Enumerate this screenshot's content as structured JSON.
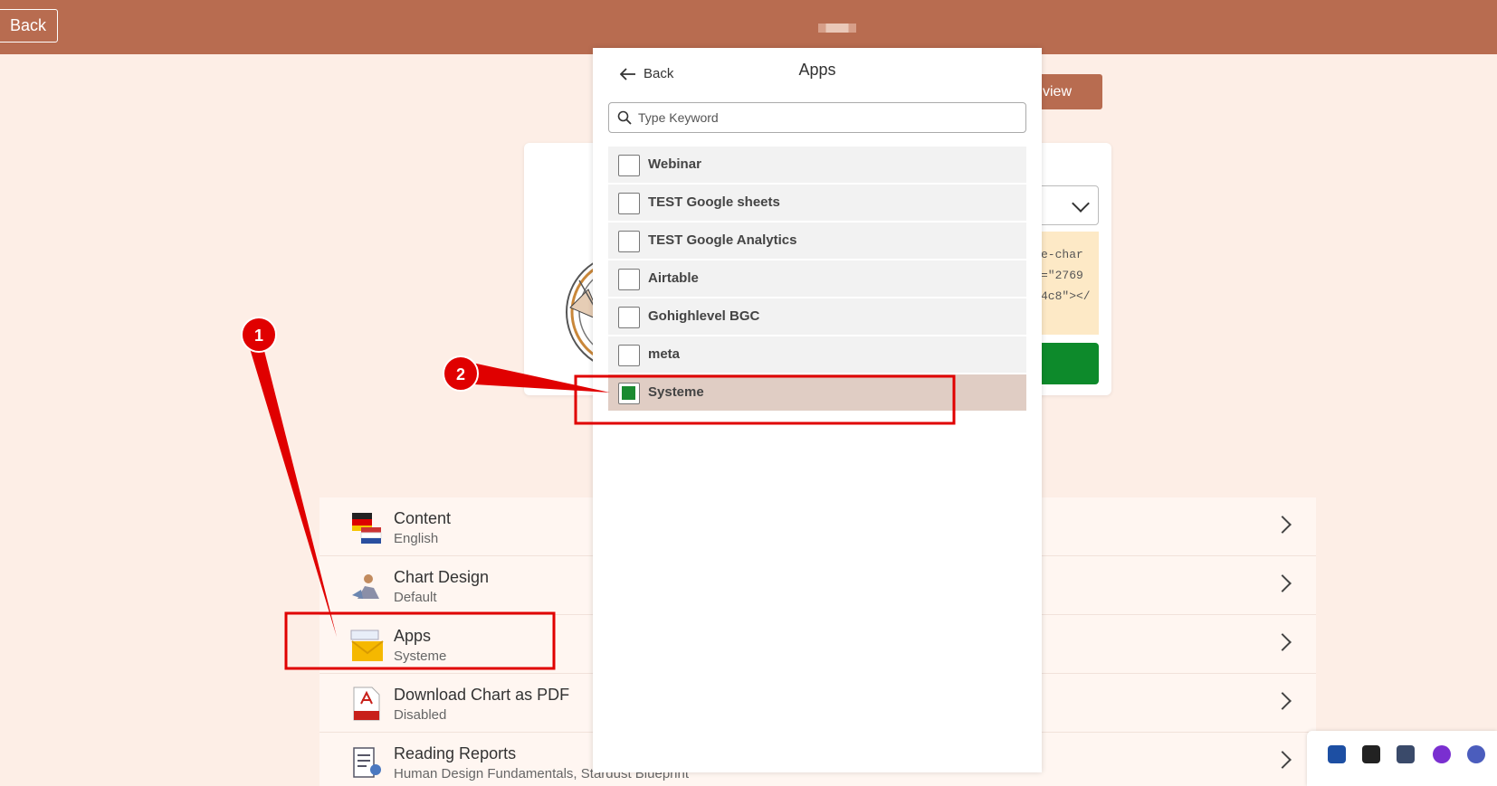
{
  "topbar": {
    "back_label": "Back"
  },
  "preview": {
    "label": "view"
  },
  "card": {
    "code_lines": [
      "e-char",
      "=\"2769",
      "4c8\"></"
    ]
  },
  "panel": {
    "back_label": "Back",
    "title": "Apps",
    "search_placeholder": "Type Keyword",
    "items": [
      {
        "label": "Webinar",
        "checked": false
      },
      {
        "label": "TEST Google sheets",
        "checked": false
      },
      {
        "label": "TEST Google Analytics",
        "checked": false
      },
      {
        "label": "Airtable",
        "checked": false
      },
      {
        "label": "Gohighlevel BGC",
        "checked": false
      },
      {
        "label": "meta",
        "checked": false
      },
      {
        "label": "Systeme",
        "checked": true
      }
    ]
  },
  "settings": {
    "rows": [
      {
        "title": "Content",
        "subtitle": "English",
        "icon": "language-flags-icon"
      },
      {
        "title": "Chart Design",
        "subtitle": "Default",
        "icon": "chart-design-icon"
      },
      {
        "title": "Apps",
        "subtitle": "Systeme",
        "icon": "apps-envelope-icon"
      },
      {
        "title": "Download Chart as PDF",
        "subtitle": "Disabled",
        "icon": "pdf-icon"
      },
      {
        "title": "Reading Reports",
        "subtitle": "Human Design Fundamentals, Stardust Blueprint",
        "icon": "reports-icon"
      }
    ]
  },
  "annotations": {
    "marker1": "1",
    "marker2": "2"
  },
  "colors": {
    "brand": "#b86c50",
    "accent_green": "#1a8a30",
    "annotation_red": "#e00000"
  }
}
